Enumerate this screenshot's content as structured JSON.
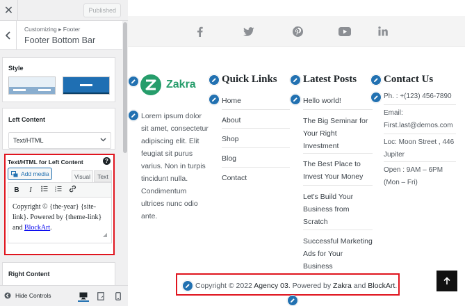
{
  "topbar": {
    "close_glyph": "✕",
    "publish_label": "Published"
  },
  "section": {
    "breadcrumb": "Customizing ▸ Footer",
    "title": "Footer Bottom Bar"
  },
  "style_panel": {
    "label": "Style"
  },
  "left_content": {
    "label": "Left Content",
    "selected": "Text/HTML"
  },
  "editor": {
    "label": "Text/HTML for Left Content",
    "add_media": "Add media",
    "tab_visual": "Visual",
    "tab_text": "Text",
    "content_prefix": "Copyright © {the-year} {site-link}. Powered by {theme-link} and ",
    "content_link": "BlockArt",
    "content_suffix": "."
  },
  "right_content": {
    "label": "Right Content"
  },
  "bottombar": {
    "hide_controls": "Hide Controls"
  },
  "preview": {
    "social_icons": [
      "facebook-icon",
      "twitter-icon",
      "pinterest-icon",
      "youtube-icon",
      "linkedin-icon"
    ],
    "brand": {
      "name": "Zakra",
      "color": "#269d6b"
    },
    "about_text": "Lorem ipsum dolor sit amet, consectetur adipiscing elit. Elit feugiat sit purus varius. Non in turpis tincidunt nulla. Condimentum ultrices nunc odio ante.",
    "quick_links": {
      "title": "Quick Links",
      "items": [
        "Home",
        "About",
        "Shop",
        "Blog",
        "Contact"
      ]
    },
    "latest_posts": {
      "title": "Latest Posts",
      "items": [
        "Hello world!",
        "The Big Seminar for Your Right Investment",
        "The Best Place to Invest Your Money",
        "Let's Build Your Business from Scratch",
        "Successful Marketing Ads for Your Business"
      ]
    },
    "contact": {
      "title": "Contact Us",
      "items": [
        "Ph. : +(123) 456-7890",
        "Email: First.last@demos.com",
        "Loc: Moon Street , 446 Jupiter",
        "Open : 9AM – 6PM (Mon – Fri)"
      ]
    },
    "copyright": {
      "prefix": "Copyright © 2022 ",
      "site": "Agency 03",
      "mid": ". Powered by ",
      "theme": "Zakra",
      "and": " and ",
      "plugin": "BlockArt",
      "end": "."
    }
  },
  "colors": {
    "accent": "#2271b1",
    "highlight": "#e0141e",
    "brand": "#269d6b"
  }
}
